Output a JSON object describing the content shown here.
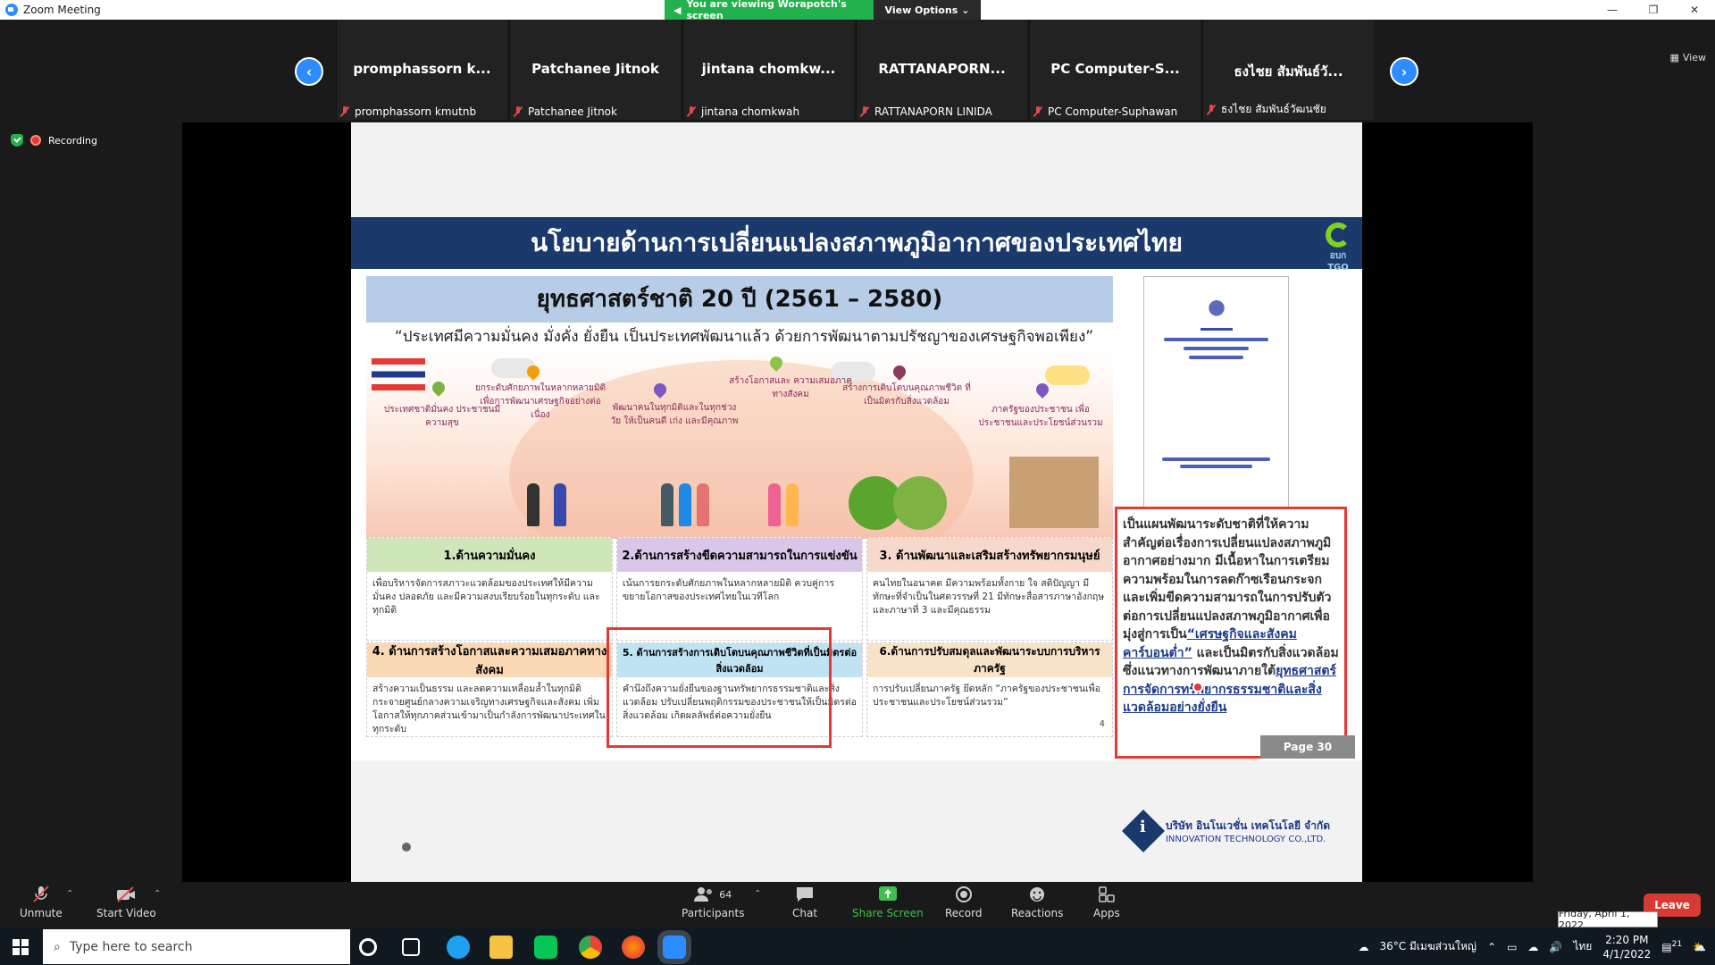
{
  "window": {
    "title": "Zoom Meeting",
    "minimize": "—",
    "restore": "❐",
    "close": "✕"
  },
  "share": {
    "banner": "You are viewing Worapotch's screen",
    "options": "View Options"
  },
  "gallery": {
    "view_label": "View",
    "participants": [
      {
        "display": "promphassorn k...",
        "name": "promphassorn kmutnb"
      },
      {
        "display": "Patchanee Jitnok",
        "name": "Patchanee Jitnok"
      },
      {
        "display": "jintana chomkw...",
        "name": "jintana chomkwah"
      },
      {
        "display": "RATTANAPORN...",
        "name": "RATTANAPORN LINIDA"
      },
      {
        "display": "PC Computer-S...",
        "name": "PC Computer-Suphawan"
      },
      {
        "display": "ธงไชย สัมพันธ์วั...",
        "name": "ธงไชย สัมพันธ์วัฒนชัย"
      }
    ]
  },
  "recording": {
    "label": "Recording"
  },
  "slide": {
    "banner": "นโยบายด้านการเปลี่ยนแปลงสภาพภูมิอากาศของประเทศไทย",
    "logo_text": "อบก TGO",
    "strategy_title": "ยุทธศาสตร์ชาติ 20 ปี (2561 – 2580)",
    "quote": "“ประเทศมีความมั่นคง มั่งคั่ง ยั่งยืน เป็นประเทศพัฒนาแล้ว ด้วยการพัฒนาตามปรัชญาของเศรษฐกิจพอเพียง”",
    "art_labels": [
      "ประเทศชาติมั่นคง ประชาชนมีความสุข",
      "ยกระดับศักยภาพในหลากหลายมิติ เพื่อการพัฒนาเศรษฐกิจอย่างต่อเนื่อง",
      "พัฒนาคนในทุกมิติและในทุกช่วงวัย ให้เป็นคนดี เก่ง และมีคุณภาพ",
      "สร้างโอกาสและ ความเสมอภาคทางสังคม",
      "สร้างการเติบโตบนคุณภาพชีวิต ที่เป็นมิตรกับสิ่งแวดล้อม",
      "ภาครัฐของประชาชน เพื่อประชาชนและประโยชน์ส่วนรวม"
    ],
    "cells": [
      {
        "head": "1.ด้านความมั่นคง",
        "body": "เพื่อบริหารจัดการสภาวะแวดล้อมของประเทศให้มีความมั่นคง ปลอดภัย และมีความสงบเรียบร้อยในทุกระดับ และทุกมิติ"
      },
      {
        "head": "2.ด้านการสร้างขีดความสามารถในการแข่งขัน",
        "body": "เน้นการยกระดับศักยภาพในหลากหลายมิติ ควบคู่การขยายโอกาสของประเทศไทยในเวทีโลก"
      },
      {
        "head": "3. ด้านพัฒนาและเสริมสร้างทรัพยากรมนุษย์",
        "body": "คนไทยในอนาคต มีความพร้อมทั้งกาย ใจ สติปัญญา มีทักษะที่จำเป็นในศตวรรษที่ 21 มีทักษะสื่อสารภาษาอังกฤษ และภาษาที่ 3 และมีคุณธรรม"
      },
      {
        "head": "4. ด้านการสร้างโอกาสและความเสมอภาคทางสังคม",
        "body": "สร้างความเป็นธรรม และลดความเหลื่อมล้ำในทุกมิติ กระจายศูนย์กลางความเจริญทางเศรษฐกิจและสังคม เพิ่มโอกาสให้ทุกภาคส่วนเข้ามาเป็นกำลังการพัฒนาประเทศในทุกระดับ"
      },
      {
        "head": "5. ด้านการสร้างการเติบโตบนคุณภาพชีวิตที่เป็นมิตรต่อสิ่งแวดล้อม",
        "body": "คำนึงถึงความยั่งยืนของฐานทรัพยากรธรรมชาติและสิ่งแวดล้อม ปรับเปลี่ยนพฤติกรรมของประชาชนให้เป็นมิตรต่อสิ่งแวดล้อม เกิดผลลัพธ์ต่อความยั่งยืน"
      },
      {
        "head": "6.ด้านการปรับสมดุลและพัฒนาระบบการบริหารภาครัฐ",
        "body": "การปรับเปลี่ยนภาครัฐ ยึดหลัก “ภาครัฐของประชาชนเพื่อประชาชนและประโยชน์ส่วนรวม”"
      }
    ],
    "cell_page_num": "4",
    "right_text_a": "เป็นแผนพัฒนาระดับชาติที่ให้ความสำคัญต่อเรื่องการเปลี่ยนแปลงสภาพภูมิอากาศอย่างมาก มีเนื้อหาในการเตรียมความพร้อมในการลดก๊าซเรือนกระจกและเพิ่มขีดความสามารถในการปรับตัวต่อการเปลี่ยนแปลงสภาพภูมิอากาศเพื่อมุ่งสู่การเป็น",
    "right_text_ul1": "“เศรษฐกิจและสังคมคาร์บอนต่ำ”",
    "right_text_b": " และเป็นมิตรกับสิ่งแวดล้อม ซึ่งแนวทางการพัฒนาภายใต้",
    "right_text_ul2": "ยุทธศาสตร์การจัดการทรัพยากรธรรมชาติและสิ่งแวดล้อมอย่างยั่งยืน",
    "page_tag": "Page 30",
    "company_th": "บริษัท อินโนเวชั่น เทคโนโลยี จำกัด",
    "company_en": "INNOVATION TECHNOLOGY CO.,LTD."
  },
  "toolbar": {
    "unmute": "Unmute",
    "start_video": "Start Video",
    "participants": "Participants",
    "participant_count": "64",
    "chat": "Chat",
    "share": "Share Screen",
    "record": "Record",
    "reactions": "Reactions",
    "apps": "Apps",
    "leave": "Leave",
    "date_tooltip": "Friday, April 1, 2022"
  },
  "taskbar": {
    "search_placeholder": "Type here to search",
    "weather": "36°C มีเมฆส่วนใหญ่",
    "lang": "ไทย",
    "time": "2:20 PM",
    "date": "4/1/2022",
    "notif_count": "21"
  }
}
